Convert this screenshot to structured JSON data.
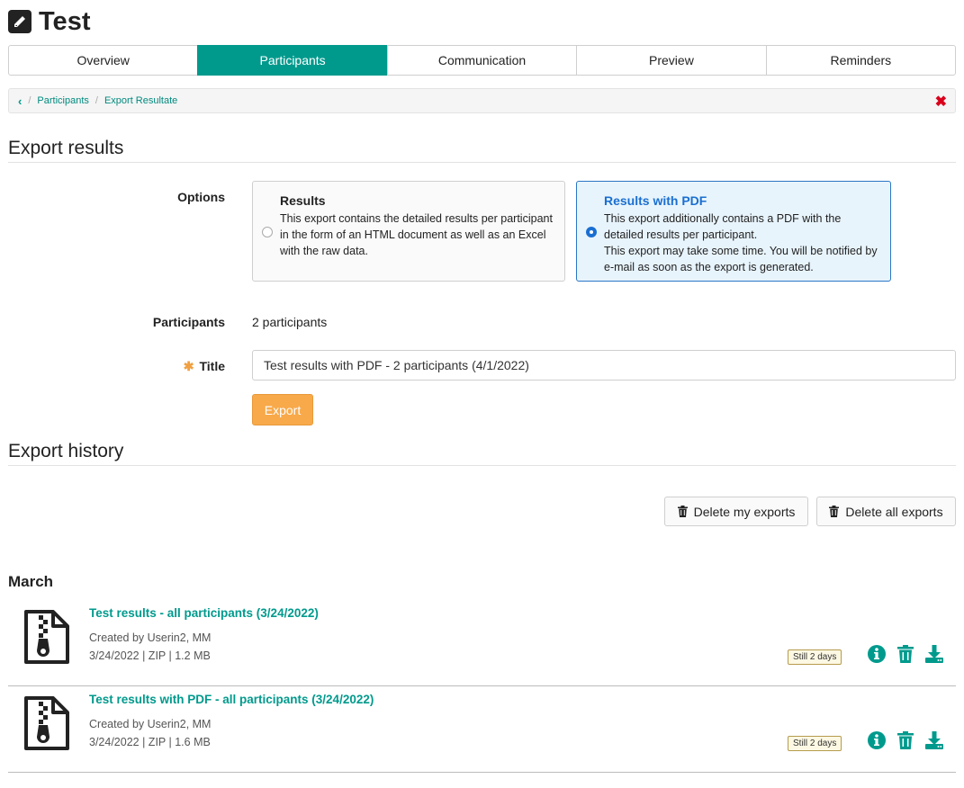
{
  "header": {
    "title": "Test",
    "icon": "pencil-icon"
  },
  "tabs": [
    {
      "label": "Overview"
    },
    {
      "label": "Participants"
    },
    {
      "label": "Communication"
    },
    {
      "label": "Preview"
    },
    {
      "label": "Reminders"
    }
  ],
  "active_tab": "Participants",
  "breadcrumb": {
    "items": [
      "Participants",
      "Export Resultate"
    ]
  },
  "export": {
    "section_title": "Export results",
    "options_label": "Options",
    "options": [
      {
        "title": "Results",
        "description": "This export contains the detailed results per participant in the form of an HTML document as well as an Excel with the raw data.",
        "selected": false
      },
      {
        "title": "Results with PDF",
        "description": "This export additionally contains a PDF with the detailed results per participant.\nThis export may take some time. You will be notified by e-mail as soon as the export is generated.",
        "selected": true
      }
    ],
    "participants_label": "Participants",
    "participants_value": "2 participants",
    "title_label": "Title",
    "title_value": "Test results with PDF - 2 participants (4/1/2022)",
    "export_button": "Export"
  },
  "history": {
    "section_title": "Export history",
    "delete_my": "Delete my exports",
    "delete_all": "Delete all exports",
    "month": "March",
    "items": [
      {
        "name": "Test results - all participants (3/24/2022)",
        "creator": "Created by Userin2, MM",
        "meta": "3/24/2022 | ZIP | 1.2 MB",
        "badge": "Still 2 days"
      },
      {
        "name": "Test results with PDF - all participants (3/24/2022)",
        "creator": "Created by Userin2, MM",
        "meta": "3/24/2022 | ZIP | 1.6 MB",
        "badge": "Still 2 days"
      }
    ]
  },
  "colors": {
    "accent": "#009a8d",
    "selected": "#1a6fd1",
    "export_button": "#f8a94a",
    "close": "#d9001b"
  }
}
